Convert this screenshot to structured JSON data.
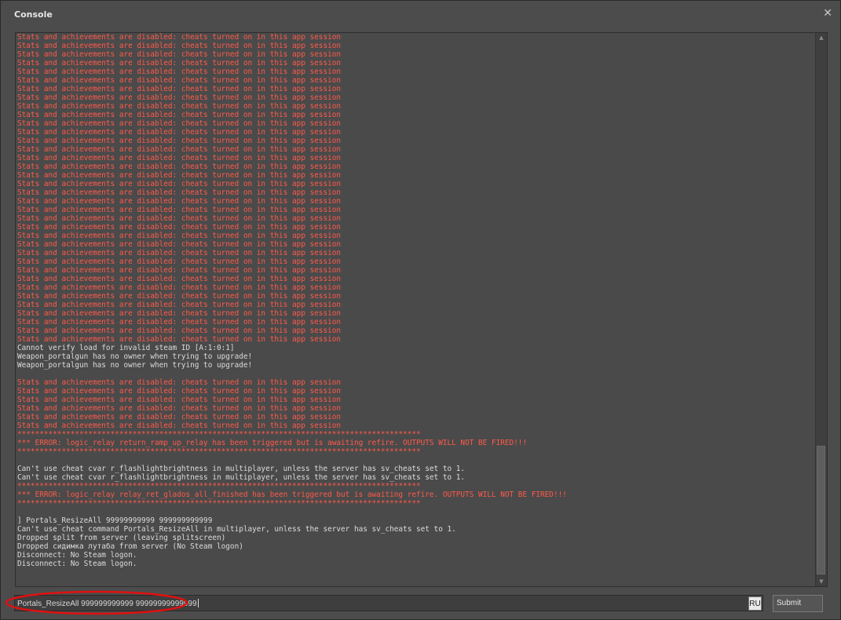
{
  "window": {
    "title": "Console",
    "close_symbol": "✕"
  },
  "colors": {
    "error": "#ff5a4a",
    "normal": "#dcdcdc",
    "annotation": "#e01010"
  },
  "log": {
    "lines": [
      {
        "t": "Stats and achievements are disabled: cheats turned on in this app session",
        "c": "error"
      },
      {
        "t": "Stats and achievements are disabled: cheats turned on in this app session",
        "c": "error"
      },
      {
        "t": "Stats and achievements are disabled: cheats turned on in this app session",
        "c": "error"
      },
      {
        "t": "Stats and achievements are disabled: cheats turned on in this app session",
        "c": "error"
      },
      {
        "t": "Stats and achievements are disabled: cheats turned on in this app session",
        "c": "error"
      },
      {
        "t": "Stats and achievements are disabled: cheats turned on in this app session",
        "c": "error"
      },
      {
        "t": "Stats and achievements are disabled: cheats turned on in this app session",
        "c": "error"
      },
      {
        "t": "Stats and achievements are disabled: cheats turned on in this app session",
        "c": "error"
      },
      {
        "t": "Stats and achievements are disabled: cheats turned on in this app session",
        "c": "error"
      },
      {
        "t": "Stats and achievements are disabled: cheats turned on in this app session",
        "c": "error"
      },
      {
        "t": "Stats and achievements are disabled: cheats turned on in this app session",
        "c": "error"
      },
      {
        "t": "Stats and achievements are disabled: cheats turned on in this app session",
        "c": "error"
      },
      {
        "t": "Stats and achievements are disabled: cheats turned on in this app session",
        "c": "error"
      },
      {
        "t": "Stats and achievements are disabled: cheats turned on in this app session",
        "c": "error"
      },
      {
        "t": "Stats and achievements are disabled: cheats turned on in this app session",
        "c": "error"
      },
      {
        "t": "Stats and achievements are disabled: cheats turned on in this app session",
        "c": "error"
      },
      {
        "t": "Stats and achievements are disabled: cheats turned on in this app session",
        "c": "error"
      },
      {
        "t": "Stats and achievements are disabled: cheats turned on in this app session",
        "c": "error"
      },
      {
        "t": "Stats and achievements are disabled: cheats turned on in this app session",
        "c": "error"
      },
      {
        "t": "Stats and achievements are disabled: cheats turned on in this app session",
        "c": "error"
      },
      {
        "t": "Stats and achievements are disabled: cheats turned on in this app session",
        "c": "error"
      },
      {
        "t": "Stats and achievements are disabled: cheats turned on in this app session",
        "c": "error"
      },
      {
        "t": "Stats and achievements are disabled: cheats turned on in this app session",
        "c": "error"
      },
      {
        "t": "Stats and achievements are disabled: cheats turned on in this app session",
        "c": "error"
      },
      {
        "t": "Stats and achievements are disabled: cheats turned on in this app session",
        "c": "error"
      },
      {
        "t": "Stats and achievements are disabled: cheats turned on in this app session",
        "c": "error"
      },
      {
        "t": "Stats and achievements are disabled: cheats turned on in this app session",
        "c": "error"
      },
      {
        "t": "Stats and achievements are disabled: cheats turned on in this app session",
        "c": "error"
      },
      {
        "t": "Stats and achievements are disabled: cheats turned on in this app session",
        "c": "error"
      },
      {
        "t": "Stats and achievements are disabled: cheats turned on in this app session",
        "c": "error"
      },
      {
        "t": "Stats and achievements are disabled: cheats turned on in this app session",
        "c": "error"
      },
      {
        "t": "Stats and achievements are disabled: cheats turned on in this app session",
        "c": "error"
      },
      {
        "t": "Stats and achievements are disabled: cheats turned on in this app session",
        "c": "error"
      },
      {
        "t": "Stats and achievements are disabled: cheats turned on in this app session",
        "c": "error"
      },
      {
        "t": "Stats and achievements are disabled: cheats turned on in this app session",
        "c": "error"
      },
      {
        "t": "Stats and achievements are disabled: cheats turned on in this app session",
        "c": "error"
      },
      {
        "t": "Cannot verify load for invalid steam ID [A:1:0:1]",
        "c": "normal"
      },
      {
        "t": "Weapon_portalgun has no owner when trying to upgrade!",
        "c": "normal"
      },
      {
        "t": "Weapon_portalgun has no owner when trying to upgrade!",
        "c": "normal"
      },
      {
        "t": "",
        "c": "normal"
      },
      {
        "t": "Stats and achievements are disabled: cheats turned on in this app session",
        "c": "error"
      },
      {
        "t": "Stats and achievements are disabled: cheats turned on in this app session",
        "c": "error"
      },
      {
        "t": "Stats and achievements are disabled: cheats turned on in this app session",
        "c": "error"
      },
      {
        "t": "Stats and achievements are disabled: cheats turned on in this app session",
        "c": "error"
      },
      {
        "t": "Stats and achievements are disabled: cheats turned on in this app session",
        "c": "error"
      },
      {
        "t": "Stats and achievements are disabled: cheats turned on in this app session",
        "c": "error"
      },
      {
        "t": "*******************************************************************************************",
        "c": "error"
      },
      {
        "t": "*** ERROR: logic_relay return_ramp_up_relay has been triggered but is awaiting refire. OUTPUTS WILL NOT BE FIRED!!!",
        "c": "error"
      },
      {
        "t": "*******************************************************************************************",
        "c": "error"
      },
      {
        "t": "",
        "c": "normal"
      },
      {
        "t": "Can't use cheat cvar r_flashlightbrightness in multiplayer, unless the server has sv_cheats set to 1.",
        "c": "normal"
      },
      {
        "t": "Can't use cheat cvar r_flashlightbrightness in multiplayer, unless the server has sv_cheats set to 1.",
        "c": "normal"
      },
      {
        "t": "*******************************************************************************************",
        "c": "error"
      },
      {
        "t": "*** ERROR: logic_relay relay_ret_glados_all_finished has been triggered but is awaiting refire. OUTPUTS WILL NOT BE FIRED!!!",
        "c": "error"
      },
      {
        "t": "*******************************************************************************************",
        "c": "error"
      },
      {
        "t": "",
        "c": "normal"
      },
      {
        "t": "] Portals_ResizeAll 99999999999 999999999999",
        "c": "normal"
      },
      {
        "t": "Can't use cheat command Portals_ResizeAll in multiplayer, unless the server has sv_cheats set to 1.",
        "c": "normal"
      },
      {
        "t": "Dropped split from server (leaving splitscreen)",
        "c": "normal"
      },
      {
        "t": "Dropped сидимка лутаба from server (No Steam logon)",
        "c": "normal"
      },
      {
        "t": "Disconnect: No Steam logon.",
        "c": "normal"
      },
      {
        "t": "Disconnect: No Steam logon.",
        "c": "normal"
      }
    ]
  },
  "input": {
    "value": "Portals_ResizeAll 999999999999 99999999999999"
  },
  "language_indicator": "RU",
  "submit_label": "Submit",
  "scroll": {
    "position_fraction": 1.0
  }
}
